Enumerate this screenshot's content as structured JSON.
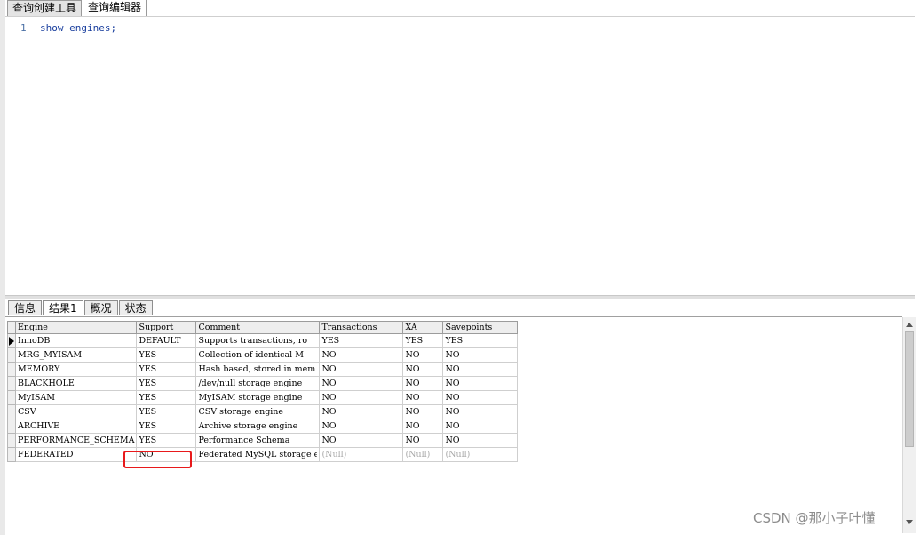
{
  "top_tabs": [
    "查询创建工具",
    "查询编辑器"
  ],
  "editor": {
    "line_number": "1",
    "code": "show engines;"
  },
  "result_tabs": [
    "信息",
    "结果1",
    "概况",
    "状态"
  ],
  "grid": {
    "columns": [
      "Engine",
      "Support",
      "Comment",
      "Transactions",
      "XA",
      "Savepoints"
    ],
    "rows": [
      [
        "InnoDB",
        "DEFAULT",
        "Supports transactions, ro",
        "YES",
        "YES",
        "YES"
      ],
      [
        "MRG_MYISAM",
        "YES",
        "Collection of identical M",
        "NO",
        "NO",
        "NO"
      ],
      [
        "MEMORY",
        "YES",
        "Hash based, stored in mem",
        "NO",
        "NO",
        "NO"
      ],
      [
        "BLACKHOLE",
        "YES",
        "/dev/null storage engine",
        "NO",
        "NO",
        "NO"
      ],
      [
        "MyISAM",
        "YES",
        "MyISAM storage engine",
        "NO",
        "NO",
        "NO"
      ],
      [
        "CSV",
        "YES",
        "CSV storage engine",
        "NO",
        "NO",
        "NO"
      ],
      [
        "ARCHIVE",
        "YES",
        "Archive storage engine",
        "NO",
        "NO",
        "NO"
      ],
      [
        "PERFORMANCE_SCHEMA",
        "YES",
        "Performance Schema",
        "NO",
        "NO",
        "NO"
      ],
      [
        "FEDERATED",
        "NO",
        "Federated MySQL storage e",
        "(Null)",
        "(Null)",
        "(Null)"
      ]
    ]
  },
  "watermark": "CSDN @那小子叶懂",
  "colors": {
    "highlight": "#e8191b",
    "keyword": "#1a3f9e"
  }
}
